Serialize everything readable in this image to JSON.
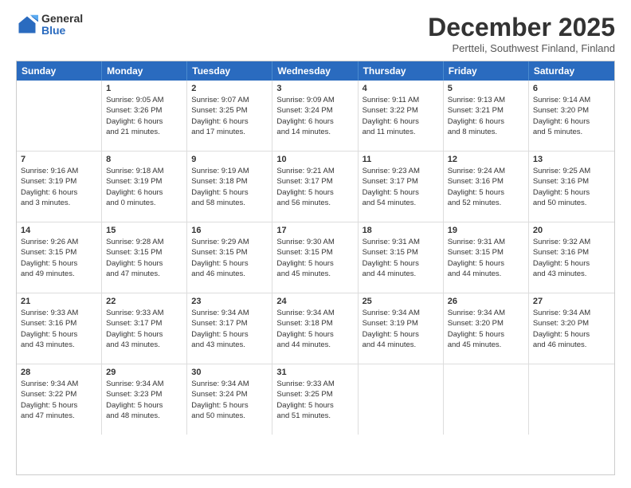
{
  "logo": {
    "general": "General",
    "blue": "Blue"
  },
  "header": {
    "title": "December 2025",
    "subtitle": "Pertteli, Southwest Finland, Finland"
  },
  "days": [
    "Sunday",
    "Monday",
    "Tuesday",
    "Wednesday",
    "Thursday",
    "Friday",
    "Saturday"
  ],
  "weeks": [
    [
      {
        "day": "",
        "lines": []
      },
      {
        "day": "1",
        "lines": [
          "Sunrise: 9:05 AM",
          "Sunset: 3:26 PM",
          "Daylight: 6 hours",
          "and 21 minutes."
        ]
      },
      {
        "day": "2",
        "lines": [
          "Sunrise: 9:07 AM",
          "Sunset: 3:25 PM",
          "Daylight: 6 hours",
          "and 17 minutes."
        ]
      },
      {
        "day": "3",
        "lines": [
          "Sunrise: 9:09 AM",
          "Sunset: 3:24 PM",
          "Daylight: 6 hours",
          "and 14 minutes."
        ]
      },
      {
        "day": "4",
        "lines": [
          "Sunrise: 9:11 AM",
          "Sunset: 3:22 PM",
          "Daylight: 6 hours",
          "and 11 minutes."
        ]
      },
      {
        "day": "5",
        "lines": [
          "Sunrise: 9:13 AM",
          "Sunset: 3:21 PM",
          "Daylight: 6 hours",
          "and 8 minutes."
        ]
      },
      {
        "day": "6",
        "lines": [
          "Sunrise: 9:14 AM",
          "Sunset: 3:20 PM",
          "Daylight: 6 hours",
          "and 5 minutes."
        ]
      }
    ],
    [
      {
        "day": "7",
        "lines": [
          "Sunrise: 9:16 AM",
          "Sunset: 3:19 PM",
          "Daylight: 6 hours",
          "and 3 minutes."
        ]
      },
      {
        "day": "8",
        "lines": [
          "Sunrise: 9:18 AM",
          "Sunset: 3:19 PM",
          "Daylight: 6 hours",
          "and 0 minutes."
        ]
      },
      {
        "day": "9",
        "lines": [
          "Sunrise: 9:19 AM",
          "Sunset: 3:18 PM",
          "Daylight: 5 hours",
          "and 58 minutes."
        ]
      },
      {
        "day": "10",
        "lines": [
          "Sunrise: 9:21 AM",
          "Sunset: 3:17 PM",
          "Daylight: 5 hours",
          "and 56 minutes."
        ]
      },
      {
        "day": "11",
        "lines": [
          "Sunrise: 9:23 AM",
          "Sunset: 3:17 PM",
          "Daylight: 5 hours",
          "and 54 minutes."
        ]
      },
      {
        "day": "12",
        "lines": [
          "Sunrise: 9:24 AM",
          "Sunset: 3:16 PM",
          "Daylight: 5 hours",
          "and 52 minutes."
        ]
      },
      {
        "day": "13",
        "lines": [
          "Sunrise: 9:25 AM",
          "Sunset: 3:16 PM",
          "Daylight: 5 hours",
          "and 50 minutes."
        ]
      }
    ],
    [
      {
        "day": "14",
        "lines": [
          "Sunrise: 9:26 AM",
          "Sunset: 3:15 PM",
          "Daylight: 5 hours",
          "and 49 minutes."
        ]
      },
      {
        "day": "15",
        "lines": [
          "Sunrise: 9:28 AM",
          "Sunset: 3:15 PM",
          "Daylight: 5 hours",
          "and 47 minutes."
        ]
      },
      {
        "day": "16",
        "lines": [
          "Sunrise: 9:29 AM",
          "Sunset: 3:15 PM",
          "Daylight: 5 hours",
          "and 46 minutes."
        ]
      },
      {
        "day": "17",
        "lines": [
          "Sunrise: 9:30 AM",
          "Sunset: 3:15 PM",
          "Daylight: 5 hours",
          "and 45 minutes."
        ]
      },
      {
        "day": "18",
        "lines": [
          "Sunrise: 9:31 AM",
          "Sunset: 3:15 PM",
          "Daylight: 5 hours",
          "and 44 minutes."
        ]
      },
      {
        "day": "19",
        "lines": [
          "Sunrise: 9:31 AM",
          "Sunset: 3:15 PM",
          "Daylight: 5 hours",
          "and 44 minutes."
        ]
      },
      {
        "day": "20",
        "lines": [
          "Sunrise: 9:32 AM",
          "Sunset: 3:16 PM",
          "Daylight: 5 hours",
          "and 43 minutes."
        ]
      }
    ],
    [
      {
        "day": "21",
        "lines": [
          "Sunrise: 9:33 AM",
          "Sunset: 3:16 PM",
          "Daylight: 5 hours",
          "and 43 minutes."
        ]
      },
      {
        "day": "22",
        "lines": [
          "Sunrise: 9:33 AM",
          "Sunset: 3:17 PM",
          "Daylight: 5 hours",
          "and 43 minutes."
        ]
      },
      {
        "day": "23",
        "lines": [
          "Sunrise: 9:34 AM",
          "Sunset: 3:17 PM",
          "Daylight: 5 hours",
          "and 43 minutes."
        ]
      },
      {
        "day": "24",
        "lines": [
          "Sunrise: 9:34 AM",
          "Sunset: 3:18 PM",
          "Daylight: 5 hours",
          "and 44 minutes."
        ]
      },
      {
        "day": "25",
        "lines": [
          "Sunrise: 9:34 AM",
          "Sunset: 3:19 PM",
          "Daylight: 5 hours",
          "and 44 minutes."
        ]
      },
      {
        "day": "26",
        "lines": [
          "Sunrise: 9:34 AM",
          "Sunset: 3:20 PM",
          "Daylight: 5 hours",
          "and 45 minutes."
        ]
      },
      {
        "day": "27",
        "lines": [
          "Sunrise: 9:34 AM",
          "Sunset: 3:20 PM",
          "Daylight: 5 hours",
          "and 46 minutes."
        ]
      }
    ],
    [
      {
        "day": "28",
        "lines": [
          "Sunrise: 9:34 AM",
          "Sunset: 3:22 PM",
          "Daylight: 5 hours",
          "and 47 minutes."
        ]
      },
      {
        "day": "29",
        "lines": [
          "Sunrise: 9:34 AM",
          "Sunset: 3:23 PM",
          "Daylight: 5 hours",
          "and 48 minutes."
        ]
      },
      {
        "day": "30",
        "lines": [
          "Sunrise: 9:34 AM",
          "Sunset: 3:24 PM",
          "Daylight: 5 hours",
          "and 50 minutes."
        ]
      },
      {
        "day": "31",
        "lines": [
          "Sunrise: 9:33 AM",
          "Sunset: 3:25 PM",
          "Daylight: 5 hours",
          "and 51 minutes."
        ]
      },
      {
        "day": "",
        "lines": []
      },
      {
        "day": "",
        "lines": []
      },
      {
        "day": "",
        "lines": []
      }
    ]
  ]
}
